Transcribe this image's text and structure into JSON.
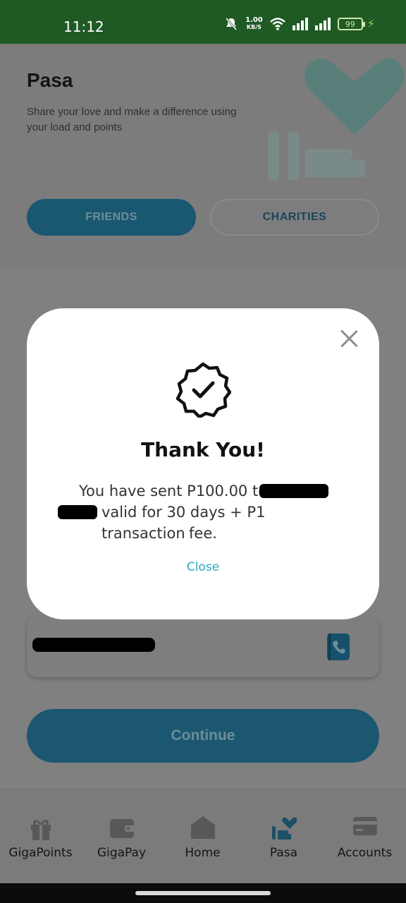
{
  "status_bar": {
    "time": "11:12",
    "net_speed_value": "1.00",
    "net_speed_unit": "KB/S",
    "battery": "99"
  },
  "header": {
    "title": "Pasa",
    "subtitle": "Share your love and make a difference using your load and points"
  },
  "tabs": [
    {
      "label": "FRIENDS",
      "active": true
    },
    {
      "label": "CHARITIES",
      "active": false
    }
  ],
  "form": {
    "continue_label": "Continue"
  },
  "modal": {
    "title": "Thank You!",
    "msg_part1": "You have sent P100.00 to",
    "msg_part2": "valid for 30 days + P1 transaction",
    "msg_part3": "fee.",
    "close_label": "Close"
  },
  "bottom_nav": [
    {
      "label": "GigaPoints",
      "icon": "gift-icon"
    },
    {
      "label": "GigaPay",
      "icon": "wallet-icon"
    },
    {
      "label": "Home",
      "icon": "home-icon"
    },
    {
      "label": "Pasa",
      "icon": "pasa-heart-icon",
      "active": true
    },
    {
      "label": "Accounts",
      "icon": "card-icon"
    }
  ],
  "colors": {
    "status_bar": "#1f5a25",
    "primary": "#1b5770",
    "link": "#2da6c4"
  }
}
